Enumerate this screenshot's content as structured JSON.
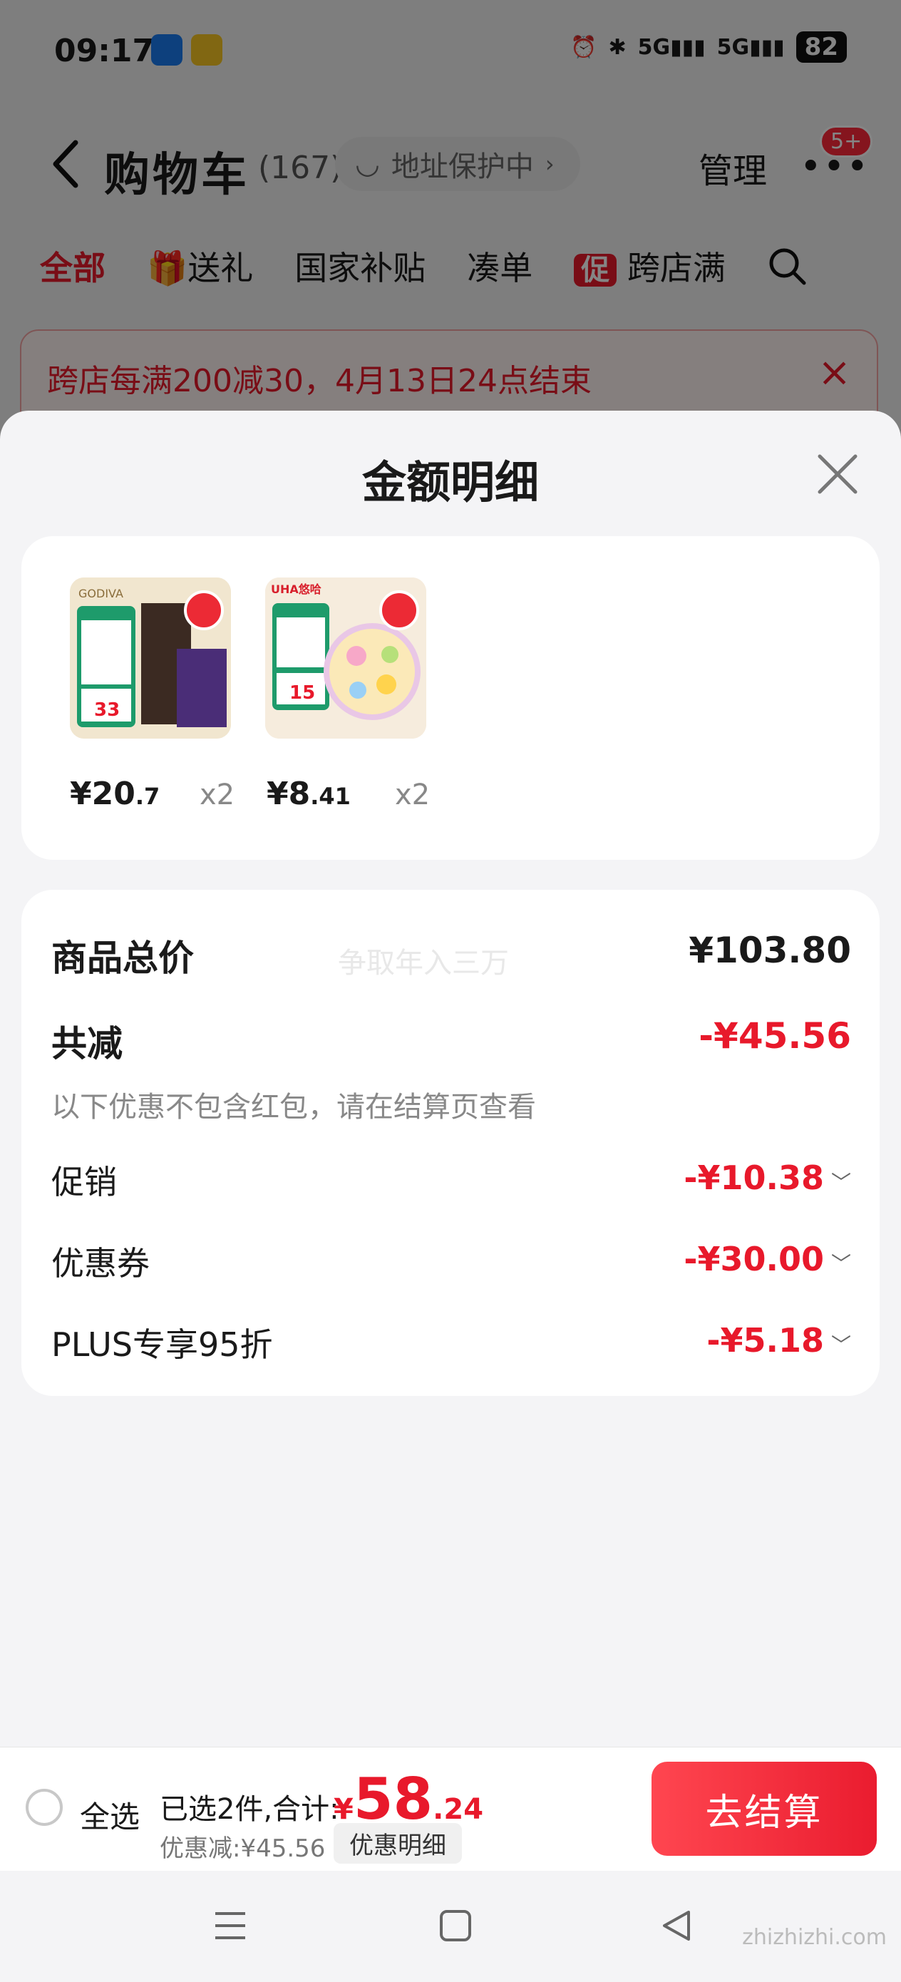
{
  "status_bar": {
    "time": "09:17",
    "signal1": "5G",
    "signal2": "5G",
    "battery": "82"
  },
  "header": {
    "title": "购物车",
    "count": "(167)",
    "address_protect": "地址保护中",
    "manage": "管理",
    "badge": "5+"
  },
  "tabs": [
    {
      "label": "全部"
    },
    {
      "label": "送礼"
    },
    {
      "label": "国家补贴"
    },
    {
      "label": "凑单"
    },
    {
      "label": "跨店满"
    }
  ],
  "promo_icon_label": "促",
  "banner": {
    "text": "跨店每满200减30，4月13日24点结束"
  },
  "sheet": {
    "title": "金额明细",
    "goods": [
      {
        "price_main": "¥20",
        "price_dec": ".7",
        "qty": "x2",
        "brand": "GODIVA",
        "tag_price": "33"
      },
      {
        "price_main": "¥8",
        "price_dec": ".41",
        "qty": "x2",
        "brand": "UHA悠哈",
        "tag_price": "15"
      }
    ],
    "detail": {
      "total_label": "商品总价",
      "total_value": "¥103.80",
      "ghost_text": "争取年入三万",
      "reduce_label": "共减",
      "reduce_value": "-¥45.56",
      "note": "以下优惠不包含红包，请在结算页查看",
      "rows": [
        {
          "label": "促销",
          "value": "-¥10.38"
        },
        {
          "label": "优惠券",
          "value": "-¥30.00"
        },
        {
          "label": "PLUS专享95折",
          "value": "-¥5.18"
        }
      ]
    }
  },
  "bottom_bar": {
    "select_all": "全选",
    "chosen": "已选2件,合计:",
    "currency": "¥",
    "total_int": "58",
    "total_dec": ".24",
    "saved": "优惠减:¥45.56",
    "detail_button": "优惠明细",
    "checkout": "去结算"
  },
  "watermark": "zhizhizhi.com",
  "colors": {
    "accent": "#e8192b",
    "checkout_gradient_start": "#ff4650",
    "checkout_gradient_end": "#ea1c2f"
  }
}
